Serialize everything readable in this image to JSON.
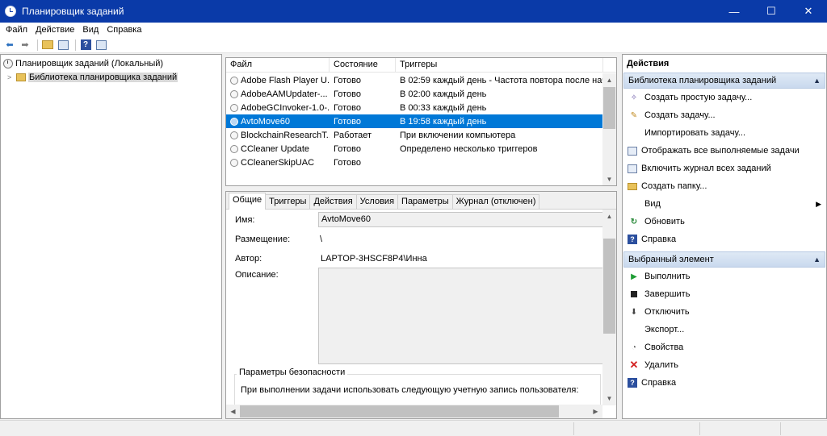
{
  "window": {
    "title": "Планировщик заданий",
    "controls": {
      "minimize": "—",
      "maximize": "☐",
      "close": "✕"
    }
  },
  "menu": [
    "Файл",
    "Действие",
    "Вид",
    "Справка"
  ],
  "tree": {
    "root": "Планировщик заданий (Локальный)",
    "library": "Библиотека планировщика заданий"
  },
  "tasks": {
    "columns": [
      "Файл",
      "Состояние",
      "Триггеры"
    ],
    "rows": [
      {
        "name": "Adobe Flash Player U...",
        "state": "Готово",
        "trigger": "В 02:59 каждый день - Частота повтора после нача"
      },
      {
        "name": "AdobeAAMUpdater-...",
        "state": "Готово",
        "trigger": "В 02:00 каждый день"
      },
      {
        "name": "AdobeGCInvoker-1.0-...",
        "state": "Готово",
        "trigger": "В 00:33 каждый день"
      },
      {
        "name": "AvtoMove60",
        "state": "Готово",
        "trigger": "В 19:58 каждый день"
      },
      {
        "name": "BlockchainResearchT...",
        "state": "Работает",
        "trigger": "При включении компьютера"
      },
      {
        "name": "CCleaner Update",
        "state": "Готово",
        "trigger": "Определено несколько триггеров"
      },
      {
        "name": "CCleanerSkipUAC",
        "state": "Готово",
        "trigger": ""
      }
    ]
  },
  "detail": {
    "tabs": [
      "Общие",
      "Триггеры",
      "Действия",
      "Условия",
      "Параметры",
      "Журнал (отключен)"
    ],
    "name_label": "Имя:",
    "name_value": "AvtoMove60",
    "location_label": "Размещение:",
    "location_value": "\\",
    "author_label": "Автор:",
    "author_value": "LAPTOP-3HSCF8P4\\Инна",
    "description_label": "Описание:",
    "security_title": "Параметры безопасности",
    "security_text": "При выполнении задачи использовать следующую учетную запись пользователя:"
  },
  "actions": {
    "title": "Действия",
    "section1": {
      "title": "Библиотека планировщика заданий",
      "items": [
        {
          "label": "Создать простую задачу...",
          "icon": "wand-icon"
        },
        {
          "label": "Создать задачу...",
          "icon": "create-task-icon"
        },
        {
          "label": "Импортировать задачу...",
          "icon": ""
        },
        {
          "label": "Отображать все выполняемые задачи",
          "icon": "list-icon"
        },
        {
          "label": "Включить журнал всех заданий",
          "icon": "log-icon"
        },
        {
          "label": "Создать папку...",
          "icon": "folder-icon"
        },
        {
          "label": "Вид",
          "icon": ""
        },
        {
          "label": "Обновить",
          "icon": "refresh-icon"
        },
        {
          "label": "Справка",
          "icon": "help-icon"
        }
      ]
    },
    "section2": {
      "title": "Выбранный элемент",
      "items": [
        {
          "label": "Выполнить",
          "icon": "run-icon"
        },
        {
          "label": "Завершить",
          "icon": "stop-icon"
        },
        {
          "label": "Отключить",
          "icon": "disable-icon"
        },
        {
          "label": "Экспорт...",
          "icon": ""
        },
        {
          "label": "Свойства",
          "icon": "properties-icon"
        },
        {
          "label": "Удалить",
          "icon": "delete-icon"
        },
        {
          "label": "Справка",
          "icon": "help-icon"
        }
      ]
    }
  },
  "colors": {
    "titlebar": "#0a3aa8",
    "selection": "#0078d7",
    "section_header": "#c9d9ee"
  }
}
